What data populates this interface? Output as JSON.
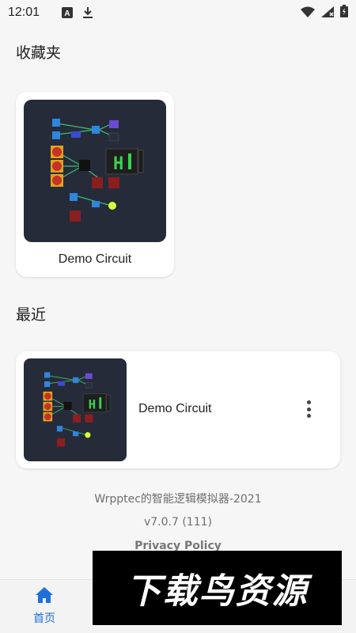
{
  "status_bar": {
    "time": "12:01",
    "icons": [
      "a-box-icon",
      "download-icon",
      "wifi-icon",
      "signal-icon",
      "battery-icon"
    ]
  },
  "favorites": {
    "title": "收藏夹",
    "card": {
      "name": "Demo Circuit"
    }
  },
  "recent": {
    "title": "最近",
    "card": {
      "name": "Demo Circuit"
    }
  },
  "footer": {
    "app_line": "Wrpptec的智能逻辑模拟器-2021",
    "version": "v7.0.7 (111)",
    "privacy": "Privacy Policy"
  },
  "bottom_nav": {
    "home_label": "首页"
  },
  "watermark": {
    "text": "下载鸟资源"
  },
  "colors": {
    "accent": "#1e6fd9",
    "thumb_bg": "#262b39",
    "red_node": "#c83028",
    "orange_node": "#e3a21a",
    "blue_node": "#2e86de",
    "green_display": "#39d353",
    "yellow_led": "#d6ff3a"
  }
}
